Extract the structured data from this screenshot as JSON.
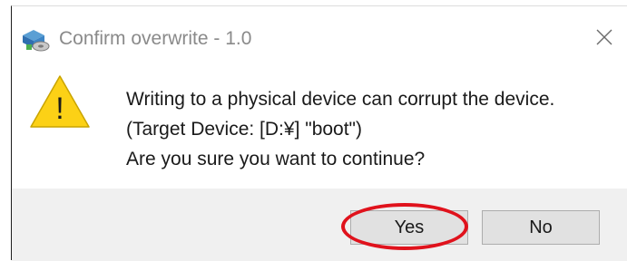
{
  "window": {
    "title": "Confirm overwrite - 1.0",
    "app_icon": "disk-writer-icon",
    "close_icon": "close-icon"
  },
  "dialog": {
    "icon": "warning-icon",
    "icon_glyph": "!",
    "message_lines": [
      "Writing to a physical device can corrupt the device.",
      "(Target Device: [D:¥] \"boot\")",
      "Are you sure you want to continue?"
    ]
  },
  "buttons": {
    "yes_label": "Yes",
    "no_label": "No"
  },
  "colors": {
    "warning_yellow": "#fcd116",
    "highlight_ring": "#e0121c",
    "footer_bg": "#f0f0f0",
    "button_bg": "#e1e1e1"
  }
}
